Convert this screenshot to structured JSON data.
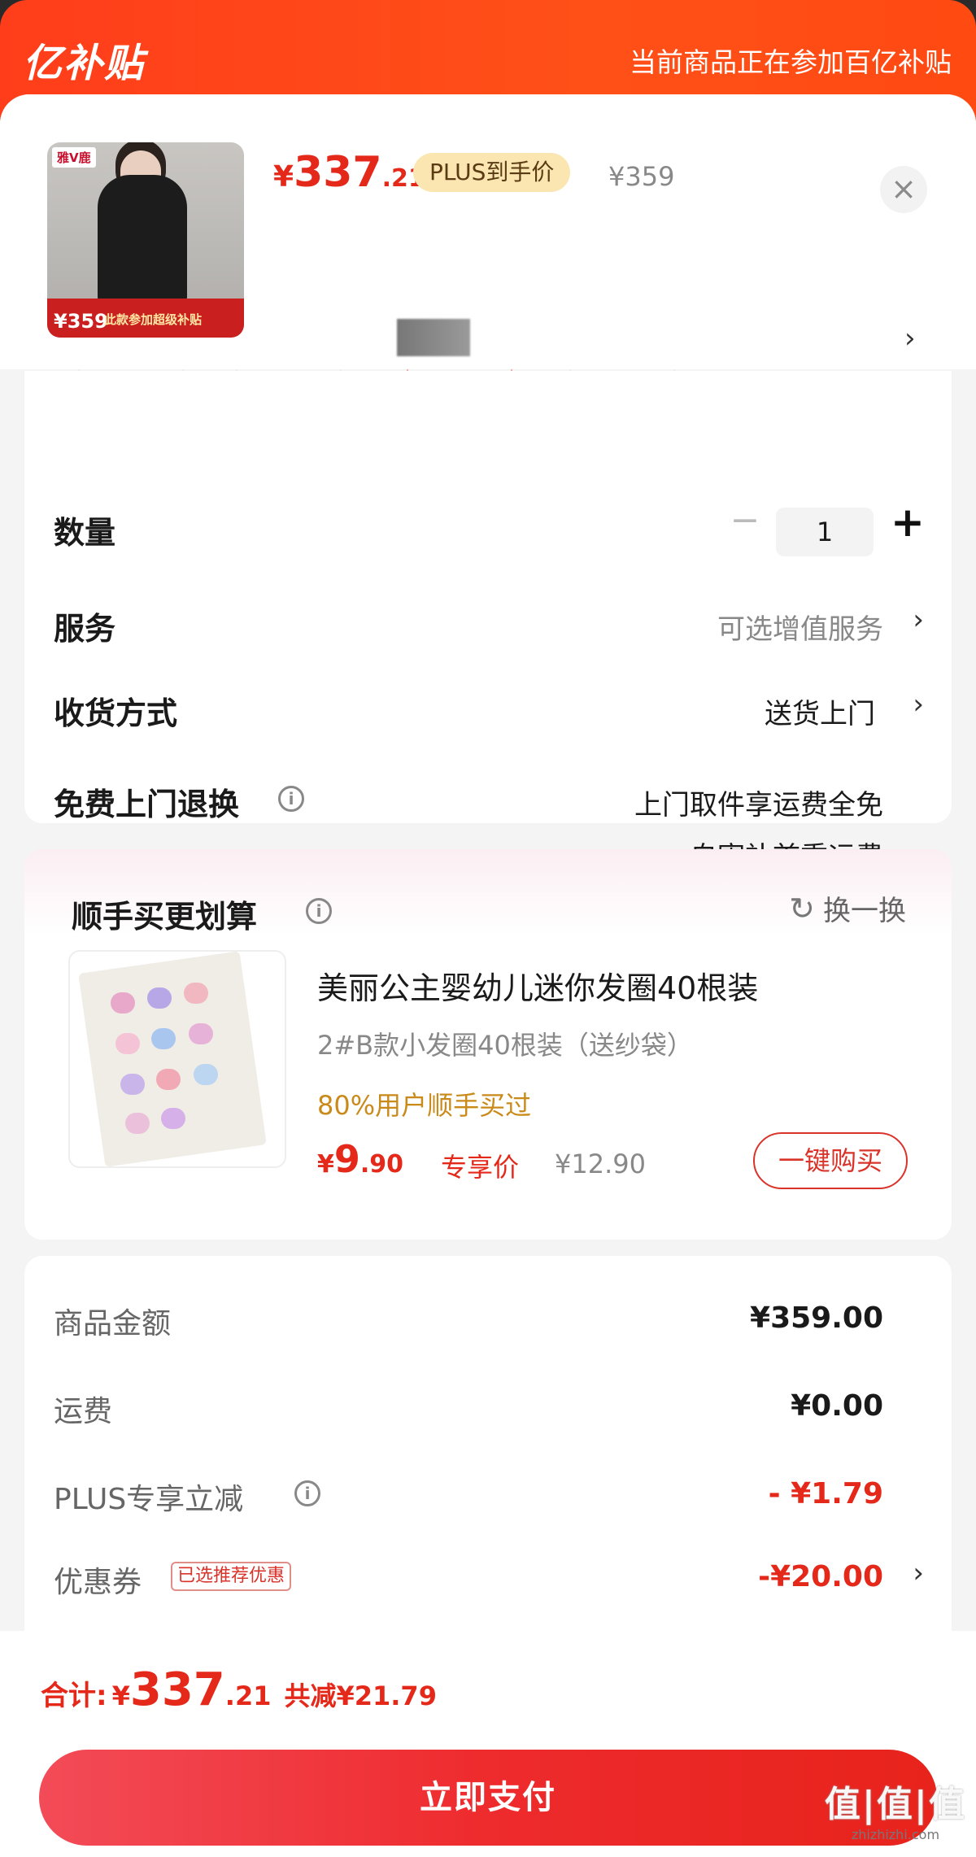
{
  "banner": {
    "logo_mark": "亿",
    "logo_text": "亿补贴",
    "notice": "当前商品正在参加百亿补贴"
  },
  "product": {
    "thumb_brand": "雅V鹿",
    "thumb_price": "¥359",
    "thumb_promo": "此款参加超级补贴",
    "price_currency": "¥",
    "price_integer": "337",
    "price_decimal": ".21",
    "plus_badge": "PLUS到手价",
    "original_price": "¥359",
    "close_glyph": "×",
    "spec_chevron": "›"
  },
  "options": {
    "quantity_label": "数量",
    "quantity_minus": "−",
    "quantity_value": "1",
    "quantity_plus": "+",
    "service_label": "服务",
    "service_value": "可选增值服务",
    "delivery_label": "收货方式",
    "delivery_value": "送货上门",
    "return_label": "免费上门退换",
    "return_value_line1": "上门取件享运费全免",
    "return_value_line2": "自寄补首重运费",
    "chevron": "›",
    "info_glyph": "i"
  },
  "addon": {
    "title": "顺手买更划算",
    "swap_label": "换一换",
    "swap_icon": "↻",
    "name": "美丽公主婴幼儿迷你发圈40根装",
    "spec": "2#B款小发圈40根装（送纱袋）",
    "social_proof": "80%用户顺手买过",
    "price_currency": "¥",
    "price_integer": "9",
    "price_decimal": ".90",
    "exclusive_label": "专享价",
    "original_price": "¥12.90",
    "buy_button": "一键购买"
  },
  "costs": {
    "goods_label": "商品金额",
    "goods_value": "¥359.00",
    "shipping_label": "运费",
    "shipping_value": "¥0.00",
    "plus_label": "PLUS专享立减",
    "plus_value": "- ¥1.79",
    "coupon_label": "优惠券",
    "coupon_tag": "已选推荐优惠",
    "coupon_value": "-¥20.00"
  },
  "footer": {
    "total_label": "合计:",
    "total_currency": "¥",
    "total_integer": "337",
    "total_decimal": ".21",
    "total_saved": "共减¥21.79",
    "pay_button": "立即支付",
    "watermark": "值|值|值",
    "watermark_sub": "zhizhizhi.com"
  },
  "colors": {
    "accent_red": "#e4291b",
    "banner_orange": "#ff4a12",
    "plus_gold": "#fbe6b2"
  }
}
